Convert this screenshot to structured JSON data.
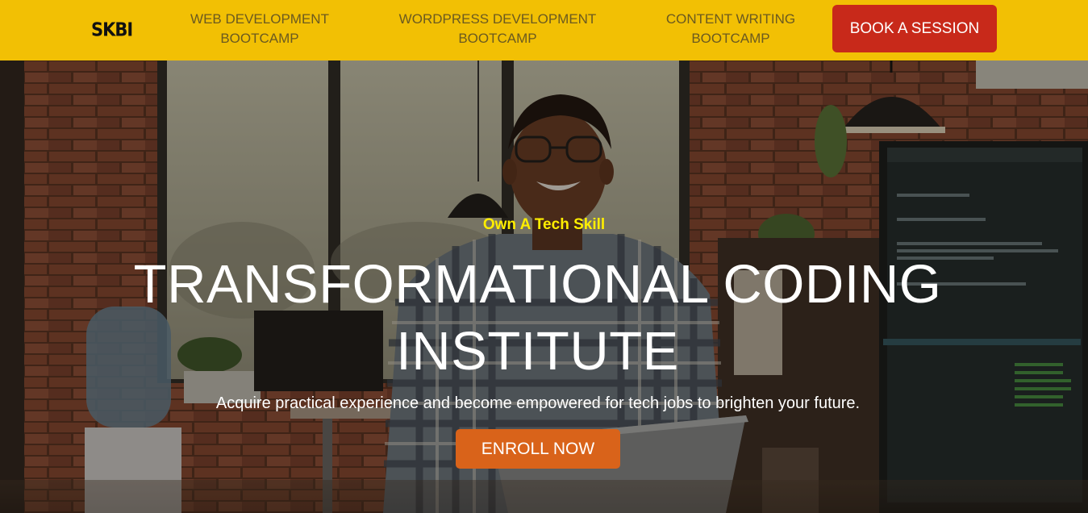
{
  "nav": {
    "logo": "SKBI",
    "links": [
      {
        "line1": "WEB DEVELOPMENT",
        "line2": "BOOTCAMP"
      },
      {
        "line1": "WORDPRESS DEVELOPMENT",
        "line2": "BOOTCAMP"
      },
      {
        "line1": "CONTENT WRITING",
        "line2": "BOOTCAMP"
      }
    ],
    "cta_label": "BOOK A SESSION"
  },
  "hero": {
    "eyebrow": "Own A Tech Skill",
    "title_line1": "TRANSFORMATIONAL CODING",
    "title_line2": "INSTITUTE",
    "subtitle": "Acquire practical experience and become empowered for tech jobs to brighten your future.",
    "button_label": "ENROLL NOW"
  },
  "colors": {
    "nav_bg": "#f2c004",
    "book_button": "#c8291a",
    "enroll_button": "#d9631a",
    "eyebrow_text": "#ffee00"
  }
}
